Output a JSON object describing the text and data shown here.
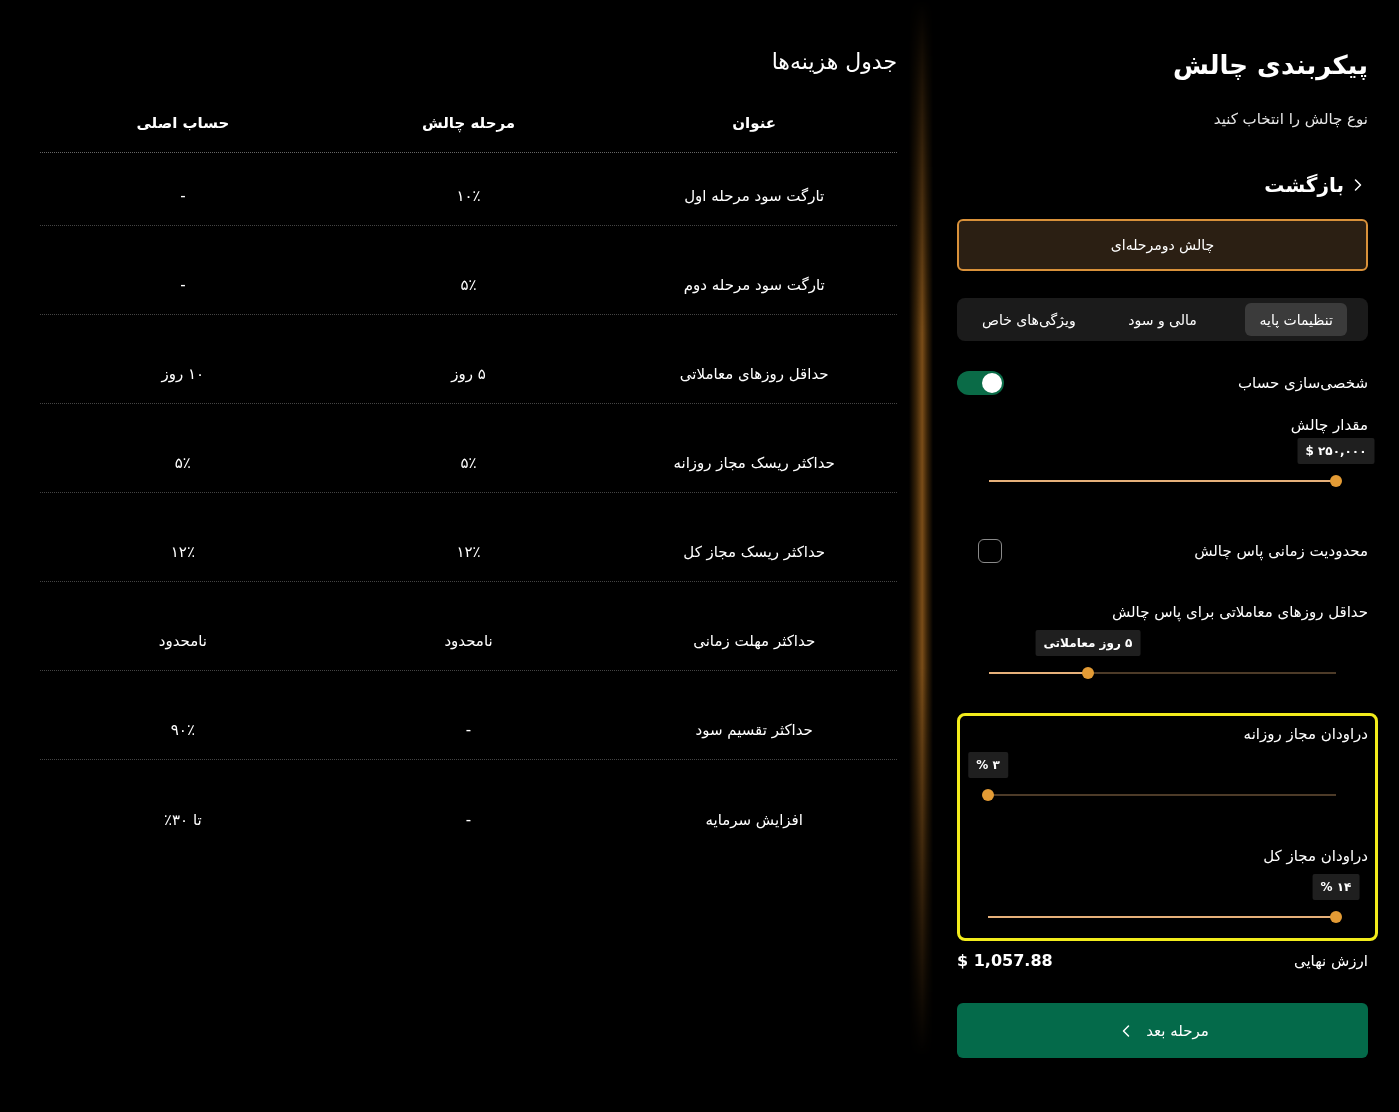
{
  "fee_table": {
    "title": "جدول هزینه‌ها",
    "columns": [
      "عنوان",
      "مرحله چالش",
      "حساب اصلی"
    ],
    "rows": [
      [
        "تارگت سود مرحله اول",
        "۱۰٪",
        "-"
      ],
      [
        "تارگت سود مرحله دوم",
        "۵٪",
        "-"
      ],
      [
        "حداقل روزهای معاملاتی",
        "۵ روز",
        "۱۰ روز"
      ],
      [
        "حداکثر ریسک مجاز روزانه",
        "۵٪",
        "۵٪"
      ],
      [
        "حداکثر ریسک مجاز کل",
        "۱۲٪",
        "۱۲٪"
      ],
      [
        "حداکثر مهلت زمانی",
        "نامحدود",
        "نامحدود"
      ],
      [
        "حداکثر تقسیم سود",
        "-",
        "۹۰٪"
      ],
      [
        "افزایش سرمایه",
        "-",
        "تا ۳۰٪"
      ]
    ]
  },
  "config": {
    "title": "پیکربندی چالش",
    "subtitle": "نوع چالش را انتخاب کنید",
    "back_link": "بازگشت",
    "challenge_types": [
      {
        "label": "چالش دومرحله‌ای",
        "selected": true
      }
    ],
    "tabs": [
      {
        "label": "تنظیمات پایه",
        "selected": true
      },
      {
        "label": "مالی و سود",
        "selected": false
      },
      {
        "label": "ویژگی‌های خاص",
        "selected": false
      }
    ],
    "settings": [
      {
        "kind": "toggle",
        "label": "شخصی‌سازی حساب",
        "on": true
      },
      {
        "kind": "slider",
        "label": "مقدار چالش",
        "value": "$ ۲۵۰,۰۰۰",
        "level": 1
      },
      {
        "kind": "checkbox",
        "label": "محدودیت زمانی پاس چالش",
        "checked": false
      },
      {
        "kind": "slider",
        "label": "حداقل روزهای معاملاتی برای پاس چالش",
        "value": "۵ روز معاملاتی",
        "level": 0.285
      }
    ],
    "highlighted_section": {
      "highlighted": true,
      "sliders": [
        {
          "label": "دراودان مجاز روزانه",
          "value": "۳ %",
          "level": 0
        },
        {
          "label": "دراودان مجاز کل",
          "value": "۱۴ %",
          "level": 1
        }
      ]
    },
    "final_value": {
      "label": "ارزش نهایی",
      "value": "$ 1,057.88"
    },
    "next_button": "مرحله بعد"
  }
}
